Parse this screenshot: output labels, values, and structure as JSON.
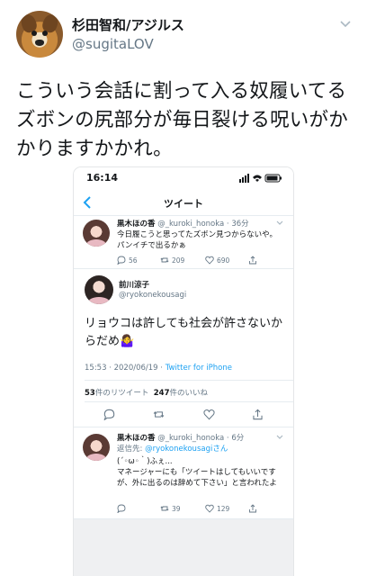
{
  "outer": {
    "name": "杉田智和/アジルス",
    "handle": "@sugitaLOV",
    "text": "こういう会話に割って入る奴履いてるズボンの尻部分が毎日裂ける呪いがかかりますかかれ。"
  },
  "phone": {
    "status_time": "16:14",
    "nav_title": "ツイート"
  },
  "reply1": {
    "name": "黒木ほの香",
    "meta": "@_kuroki_honoka · 36分",
    "text": "今日履こうと思ってたズボン見つからないや。パンイチで出るかぁ",
    "replies": "56",
    "retweets": "209",
    "likes": "690"
  },
  "main": {
    "name": "前川涼子",
    "handle": "@ryokonekousagi",
    "text": "リョウコは許しても社会が許さないからだめ🤷‍♀️",
    "time": "15:53 · 2020/06/19 · ",
    "source": "Twitter for iPhone",
    "retweets_count": "53",
    "retweets_label": "件のリツイート",
    "likes_count": "247",
    "likes_label": "件のいいね"
  },
  "reply2": {
    "name": "黒木ほの香",
    "meta": "@_kuroki_honoka · 6分",
    "reply_to_prefix": "返信先: ",
    "reply_to": "@ryokonekousagiさん",
    "text1": "(´◦ω◦｀)ふぇ...",
    "text2": "マネージャーにも「ツイートはしてもいいですが、外に出るのは辞めて下さい」と言われたよ",
    "retweets": "39",
    "likes": "129"
  },
  "colors": {
    "link": "#1da1f2",
    "muted": "#657786"
  }
}
